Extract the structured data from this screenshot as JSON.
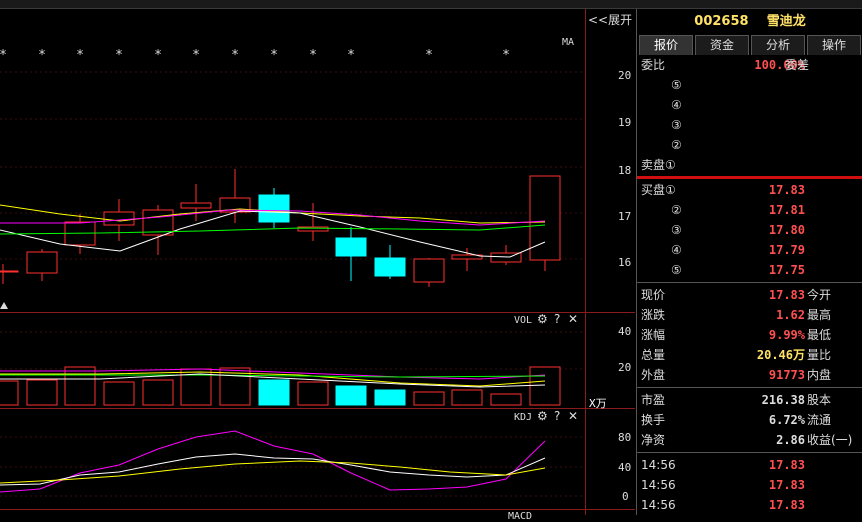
{
  "chart": {
    "expand_label": "<<展开",
    "ma_label": "MA",
    "price_ticks": [
      "20",
      "19",
      "18",
      "17",
      "16"
    ],
    "vol_label": "VOL",
    "vol_ticks": [
      "40",
      "20"
    ],
    "vol_unit": "X万",
    "kdj_label": "KDJ",
    "kdj_ticks": [
      "80",
      "40",
      "0"
    ],
    "macd_label": "MACD",
    "star": "*"
  },
  "quote": {
    "code": "002658",
    "name": "雪迪龙",
    "tabs": [
      "报价",
      "资金",
      "分析",
      "操作"
    ],
    "weibi_label": "委比",
    "weibi_value": "100.00%",
    "weicha_label": "委差",
    "sell_rows": [
      "⑤",
      "④",
      "③",
      "②"
    ],
    "sell1_label": "卖盘①",
    "buy1_label": "买盘①",
    "buy_rows": [
      {
        "idx": "买盘①",
        "price": "17.83"
      },
      {
        "idx": "②",
        "price": "17.81"
      },
      {
        "idx": "③",
        "price": "17.80"
      },
      {
        "idx": "④",
        "price": "17.79"
      },
      {
        "idx": "⑤",
        "price": "17.75"
      }
    ],
    "stats": [
      {
        "l": "现价",
        "v": "17.83",
        "r": "今开",
        "color": "#ff5050"
      },
      {
        "l": "涨跌",
        "v": "1.62",
        "r": "最高",
        "color": "#ff5050"
      },
      {
        "l": "涨幅",
        "v": "9.99%",
        "r": "最低",
        "color": "#ff5050"
      },
      {
        "l": "总量",
        "v": "20.46万",
        "r": "量比",
        "color": "#ffe266"
      },
      {
        "l": "外盘",
        "v": "91773",
        "r": "内盘",
        "color": "#ff5050"
      }
    ],
    "stats2": [
      {
        "l": "市盈",
        "v": "216.38",
        "r": "股本"
      },
      {
        "l": "换手",
        "v": "6.72%",
        "r": "流通"
      },
      {
        "l": "净资",
        "v": "2.86",
        "r": "收益(一)"
      }
    ],
    "ticks": [
      {
        "t": "14:56",
        "p": "17.83"
      },
      {
        "t": "14:56",
        "p": "17.83"
      },
      {
        "t": "14:56",
        "p": "17.83"
      }
    ]
  },
  "colors": {
    "up": "#ff3030",
    "down": "#00ffff",
    "ma5": "#ffffff",
    "ma10": "#ffff00",
    "ma20": "#ff00ff",
    "ma60": "#00ff00"
  }
}
